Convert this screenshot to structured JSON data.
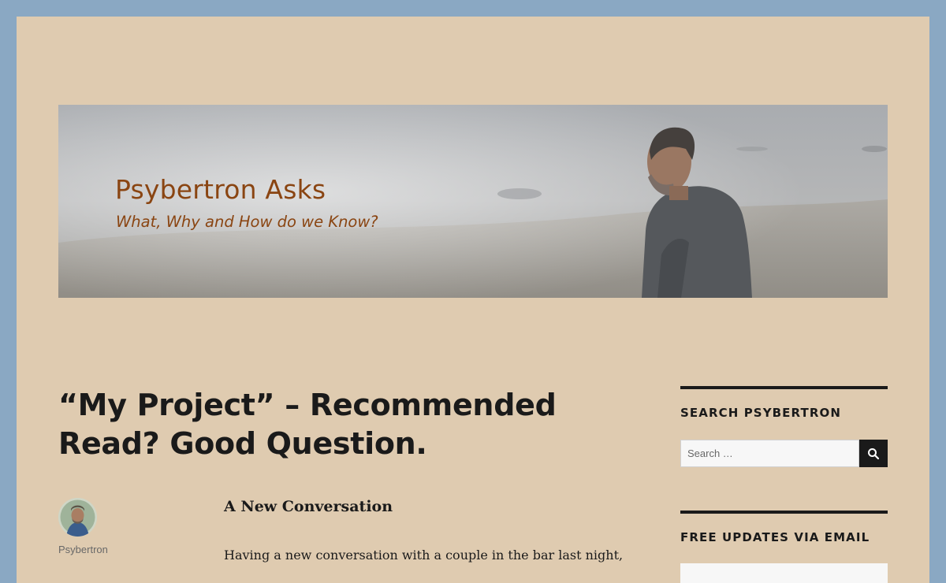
{
  "header": {
    "banner_title": "Psybertron Asks",
    "banner_subtitle": "What, Why and How do we Know?"
  },
  "post": {
    "title": "“My Project” – Recommended Read? Good Question.",
    "author": "Psybertron",
    "subheading": "A New Conversation",
    "paragraph": "Having a new conversation with a couple in the bar last night,"
  },
  "sidebar": {
    "search_widget_title": "SEARCH PSYBERTRON",
    "search_placeholder": "Search …",
    "search_button_icon": "search-icon",
    "email_widget_title": "FREE UPDATES VIA EMAIL"
  },
  "colors": {
    "outer_background": "#8aa8c3",
    "page_background": "#dfcbb0",
    "text": "#1a1a1a",
    "banner_text": "#8a4512"
  }
}
